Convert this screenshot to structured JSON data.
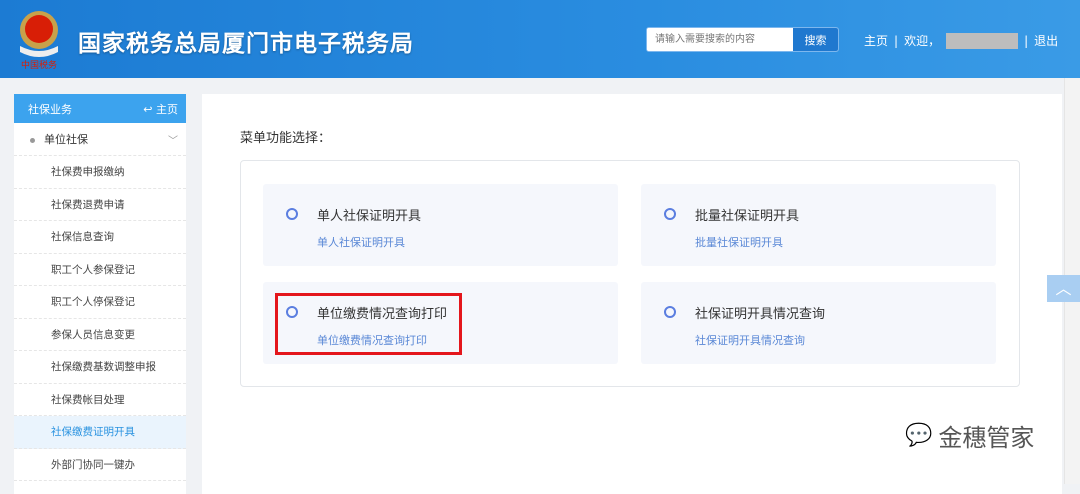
{
  "header": {
    "title": "国家税务总局厦门市电子税务局",
    "logo_text": "中国税务",
    "search_placeholder": "请输入需要搜索的内容",
    "search_button": "搜索",
    "home_link": "主页",
    "separator": "|",
    "welcome": "欢迎，",
    "logout": "退出"
  },
  "sidebar": {
    "title": "社保业务",
    "home": "主页",
    "group": "单位社保",
    "items": [
      "社保费申报缴纳",
      "社保费退费申请",
      "社保信息查询",
      "职工个人参保登记",
      "职工个人停保登记",
      "参保人员信息变更",
      "社保缴费基数调整申报",
      "社保费帐目处理",
      "社保缴费证明开具",
      "外部门协同一键办"
    ],
    "active_index": 8
  },
  "main": {
    "menu_title": "菜单功能选择：",
    "cards": [
      {
        "title": "单人社保证明开具",
        "sub": "单人社保证明开具"
      },
      {
        "title": "批量社保证明开具",
        "sub": "批量社保证明开具"
      },
      {
        "title": "单位缴费情况查询打印",
        "sub": "单位缴费情况查询打印"
      },
      {
        "title": "社保证明开具情况查询",
        "sub": "社保证明开具情况查询"
      }
    ]
  },
  "watermark": "金穗管家",
  "colors": {
    "header": "#1c7bd3",
    "accent": "#3ca3ee",
    "highlight": "#e4161c"
  }
}
